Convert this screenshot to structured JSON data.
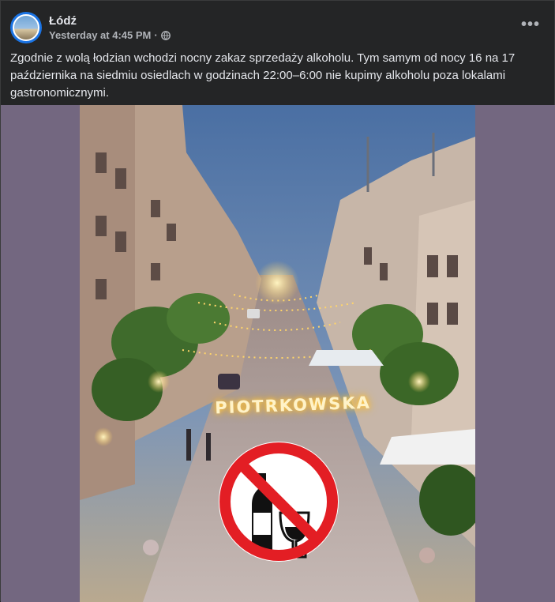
{
  "post": {
    "page_name": "Łódź",
    "timestamp": "Yesterday at 4:45 PM",
    "separator": "·",
    "privacy_icon": "globe-icon",
    "more_icon": "more-options-icon",
    "more_glyph": "•••",
    "text": "Zgodnie z wolą łodzian wchodzi nocny zakaz sprzedaży alkoholu. Tym samym od nocy 16 na 17 października na siedmiu osiedlach w godzinach 22:00–6:00 nie kupimy alkoholu poza lokalami gastronomicznymi."
  },
  "image": {
    "street_sign": "PIOTRKOWSKA",
    "prohibition_icon": "no-alcohol-icon"
  },
  "colors": {
    "background": "#242526",
    "text": "#e4e6eb",
    "secondary_text": "#b0b3b8",
    "media_backdrop": "#736780",
    "prohibition_red": "#e31e24"
  }
}
